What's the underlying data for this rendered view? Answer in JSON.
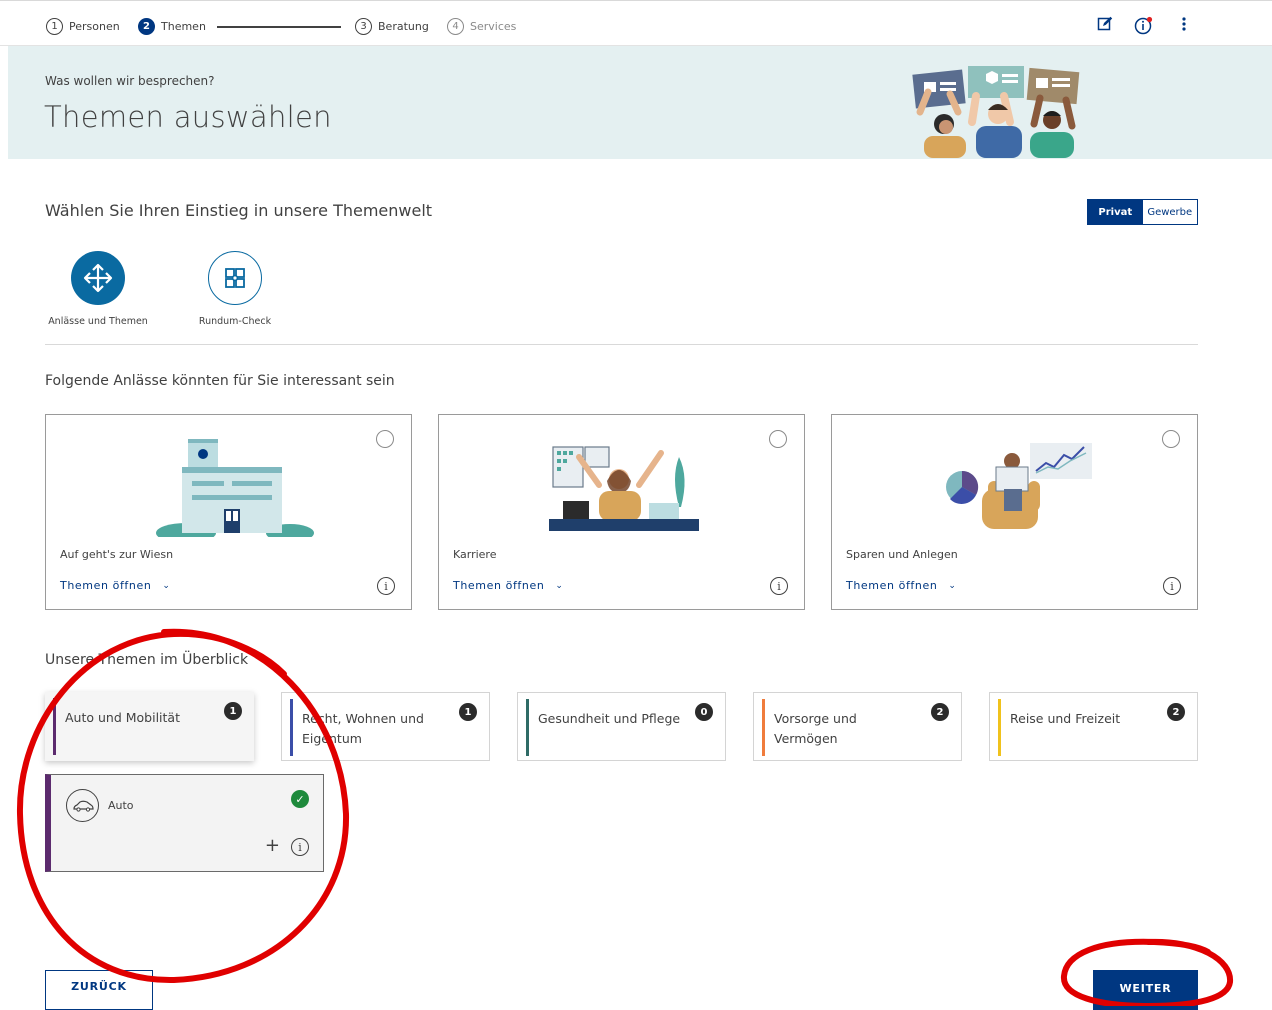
{
  "stepper": {
    "steps": [
      {
        "num": "1",
        "label": "Personen"
      },
      {
        "num": "2",
        "label": "Themen"
      },
      {
        "num": "3",
        "label": "Beratung"
      },
      {
        "num": "4",
        "label": "Services"
      }
    ],
    "icons": [
      "edit-icon",
      "info-alert-icon",
      "more-vertical-icon"
    ]
  },
  "hero": {
    "subtitle": "Was wollen wir besprechen?",
    "title": "Themen auswählen"
  },
  "entry_section": {
    "heading": "Wählen Sie Ihren Einstieg in unsere Themenwelt",
    "toggle": {
      "privat": "Privat",
      "gewerbe": "Gewerbe",
      "selected": "Privat"
    },
    "options": [
      {
        "label": "Anlässe und Themen",
        "icon": "arrows-split-icon",
        "selected": true
      },
      {
        "label": "Rundum-Check",
        "icon": "puzzle-icon",
        "selected": false
      }
    ]
  },
  "occasions": {
    "heading": "Folgende Anlässe könnten für Sie interessant sein",
    "cards": [
      {
        "title": "Auf geht's zur Wiesn",
        "link": "Themen öffnen",
        "image": "building-illustration"
      },
      {
        "title": "Karriere",
        "link": "Themen öffnen",
        "image": "celebrating-person-illustration"
      },
      {
        "title": "Sparen und Anlegen",
        "link": "Themen öffnen",
        "image": "reading-person-chart-illustration"
      }
    ]
  },
  "topics": {
    "heading": "Unsere Themen im Überblick",
    "tiles": [
      {
        "label": "Auto und Mobilität",
        "count": "1",
        "color": "#5c2b6e"
      },
      {
        "label": "Recht, Wohnen und Eigentum",
        "count": "1",
        "color": "#3b4ea8"
      },
      {
        "label": "Gesundheit und Pflege",
        "count": "0",
        "color": "#2f6b66"
      },
      {
        "label": "Vorsorge und Vermögen",
        "count": "2",
        "color": "#f07c3c"
      },
      {
        "label": "Reise und Freizeit",
        "count": "2",
        "color": "#f0c21c"
      }
    ],
    "expanded": {
      "name": "Auto",
      "icon": "car-icon",
      "checked": true
    }
  },
  "buttons": {
    "back": "ZURÜCK",
    "next": "WEITER"
  },
  "colors": {
    "primary": "#003781",
    "hero_bg": "#e4f0f1",
    "annotation": "#e00000",
    "success": "#1e8a3c"
  }
}
